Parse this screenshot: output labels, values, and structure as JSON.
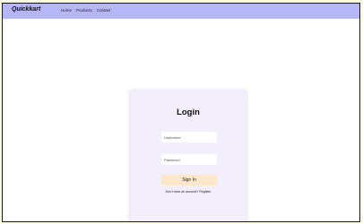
{
  "navbar": {
    "brand": "Quickkart",
    "links": [
      "Home",
      "Products",
      "Contact"
    ]
  },
  "login": {
    "title": "Login",
    "username_placeholder": "Username",
    "password_placeholder": "Password",
    "signin_label": "Sign In",
    "register_prompt": "Don't have an account? ",
    "register_link": "Register"
  },
  "colors": {
    "navbar_bg": "#b5b6f7",
    "card_bg": "#f2eefc",
    "button_bg": "#ffe8c9",
    "outer_bg": "#fbfbe6"
  }
}
